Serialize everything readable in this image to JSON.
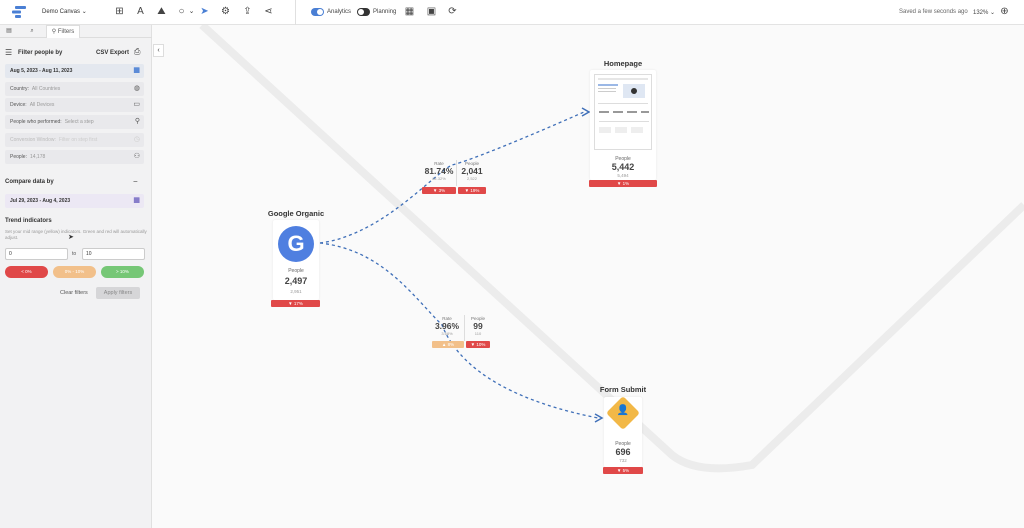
{
  "topbar": {
    "canvas_name": "Demo Canvas",
    "analytics_label": "Analytics",
    "planning_label": "Planning",
    "saved_text": "Saved a few seconds ago",
    "zoom": "132%"
  },
  "sidebar": {
    "tab_filters": "Filters",
    "filter_title": "Filter people by",
    "csv_export": "CSV Export",
    "date_range": "Aug 5, 2023 - Aug 11, 2023",
    "country_label": "Country:",
    "country_value": "All Countries",
    "device_label": "Device:",
    "device_value": "All Devices",
    "performed_label": "People who performed:",
    "performed_value": "Select a step",
    "conversion_label": "Conversion Window:",
    "conversion_value": "Filter on step first",
    "people_label": "People:",
    "people_value": "14,178",
    "compare_title": "Compare data by",
    "compare_range": "Jul 29, 2023 - Aug 4, 2023",
    "trend_title": "Trend indicators",
    "trend_note": "Set your mid range (yellow) indicators. Green and red will automatically adjust.",
    "range_from": "0",
    "range_to_label": "to",
    "range_to": "10",
    "pill_red": "< 0%",
    "pill_amber": "0% - 10%",
    "pill_green": "> 10%",
    "clear_label": "Clear filters",
    "apply_label": "Apply filters"
  },
  "nodes": {
    "google": {
      "title": "Google Organic",
      "people_label": "People",
      "value": "2,497",
      "prev": "2,951",
      "delta": "▼ 17%"
    },
    "homepage": {
      "title": "Homepage",
      "people_label": "People",
      "value": "5,442",
      "prev": "5,494",
      "delta": "▼ 1%"
    },
    "form": {
      "title": "Form Submit",
      "people_label": "People",
      "value": "696",
      "prev": "732",
      "delta": "▼ 5%"
    }
  },
  "links": {
    "to_homepage": {
      "rate_label": "Rate",
      "rate": "81.74%",
      "rate_prev": "84.32%",
      "rate_delta": "▼ 3%",
      "people_label": "People",
      "people": "2,041",
      "people_prev": "2,522",
      "people_delta": "▼ 19%"
    },
    "to_form": {
      "rate_label": "Rate",
      "rate": "3.96%",
      "rate_prev": "3.68%",
      "rate_delta": "▲ 8%",
      "people_label": "People",
      "people": "99",
      "people_prev": "110",
      "people_delta": "▼ 10%"
    }
  },
  "colors": {
    "accent": "#4a7fd4",
    "google_blue": "#4f7fe0",
    "form_amber": "#f2b847",
    "bad": "#e04848",
    "mid": "#f2c08a",
    "good": "#76c776"
  }
}
